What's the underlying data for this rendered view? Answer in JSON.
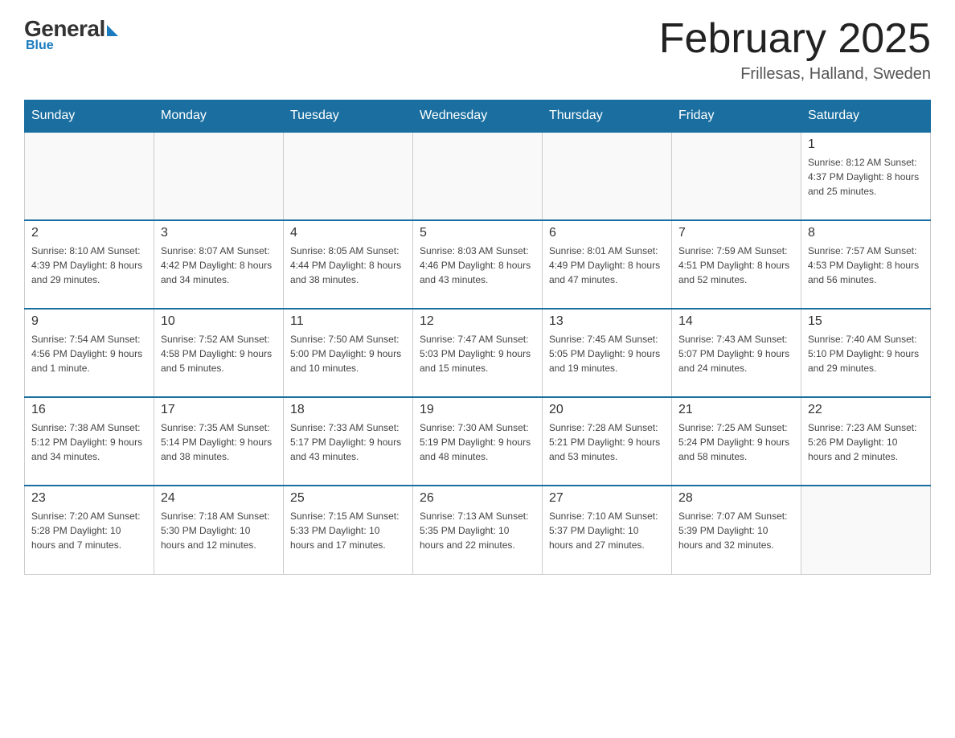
{
  "logo": {
    "general": "General",
    "blue": "Blue",
    "tagline": "Blue"
  },
  "header": {
    "title": "February 2025",
    "location": "Frillesas, Halland, Sweden"
  },
  "days_of_week": [
    "Sunday",
    "Monday",
    "Tuesday",
    "Wednesday",
    "Thursday",
    "Friday",
    "Saturday"
  ],
  "weeks": [
    [
      {
        "day": "",
        "info": ""
      },
      {
        "day": "",
        "info": ""
      },
      {
        "day": "",
        "info": ""
      },
      {
        "day": "",
        "info": ""
      },
      {
        "day": "",
        "info": ""
      },
      {
        "day": "",
        "info": ""
      },
      {
        "day": "1",
        "info": "Sunrise: 8:12 AM\nSunset: 4:37 PM\nDaylight: 8 hours and 25 minutes."
      }
    ],
    [
      {
        "day": "2",
        "info": "Sunrise: 8:10 AM\nSunset: 4:39 PM\nDaylight: 8 hours and 29 minutes."
      },
      {
        "day": "3",
        "info": "Sunrise: 8:07 AM\nSunset: 4:42 PM\nDaylight: 8 hours and 34 minutes."
      },
      {
        "day": "4",
        "info": "Sunrise: 8:05 AM\nSunset: 4:44 PM\nDaylight: 8 hours and 38 minutes."
      },
      {
        "day": "5",
        "info": "Sunrise: 8:03 AM\nSunset: 4:46 PM\nDaylight: 8 hours and 43 minutes."
      },
      {
        "day": "6",
        "info": "Sunrise: 8:01 AM\nSunset: 4:49 PM\nDaylight: 8 hours and 47 minutes."
      },
      {
        "day": "7",
        "info": "Sunrise: 7:59 AM\nSunset: 4:51 PM\nDaylight: 8 hours and 52 minutes."
      },
      {
        "day": "8",
        "info": "Sunrise: 7:57 AM\nSunset: 4:53 PM\nDaylight: 8 hours and 56 minutes."
      }
    ],
    [
      {
        "day": "9",
        "info": "Sunrise: 7:54 AM\nSunset: 4:56 PM\nDaylight: 9 hours and 1 minute."
      },
      {
        "day": "10",
        "info": "Sunrise: 7:52 AM\nSunset: 4:58 PM\nDaylight: 9 hours and 5 minutes."
      },
      {
        "day": "11",
        "info": "Sunrise: 7:50 AM\nSunset: 5:00 PM\nDaylight: 9 hours and 10 minutes."
      },
      {
        "day": "12",
        "info": "Sunrise: 7:47 AM\nSunset: 5:03 PM\nDaylight: 9 hours and 15 minutes."
      },
      {
        "day": "13",
        "info": "Sunrise: 7:45 AM\nSunset: 5:05 PM\nDaylight: 9 hours and 19 minutes."
      },
      {
        "day": "14",
        "info": "Sunrise: 7:43 AM\nSunset: 5:07 PM\nDaylight: 9 hours and 24 minutes."
      },
      {
        "day": "15",
        "info": "Sunrise: 7:40 AM\nSunset: 5:10 PM\nDaylight: 9 hours and 29 minutes."
      }
    ],
    [
      {
        "day": "16",
        "info": "Sunrise: 7:38 AM\nSunset: 5:12 PM\nDaylight: 9 hours and 34 minutes."
      },
      {
        "day": "17",
        "info": "Sunrise: 7:35 AM\nSunset: 5:14 PM\nDaylight: 9 hours and 38 minutes."
      },
      {
        "day": "18",
        "info": "Sunrise: 7:33 AM\nSunset: 5:17 PM\nDaylight: 9 hours and 43 minutes."
      },
      {
        "day": "19",
        "info": "Sunrise: 7:30 AM\nSunset: 5:19 PM\nDaylight: 9 hours and 48 minutes."
      },
      {
        "day": "20",
        "info": "Sunrise: 7:28 AM\nSunset: 5:21 PM\nDaylight: 9 hours and 53 minutes."
      },
      {
        "day": "21",
        "info": "Sunrise: 7:25 AM\nSunset: 5:24 PM\nDaylight: 9 hours and 58 minutes."
      },
      {
        "day": "22",
        "info": "Sunrise: 7:23 AM\nSunset: 5:26 PM\nDaylight: 10 hours and 2 minutes."
      }
    ],
    [
      {
        "day": "23",
        "info": "Sunrise: 7:20 AM\nSunset: 5:28 PM\nDaylight: 10 hours and 7 minutes."
      },
      {
        "day": "24",
        "info": "Sunrise: 7:18 AM\nSunset: 5:30 PM\nDaylight: 10 hours and 12 minutes."
      },
      {
        "day": "25",
        "info": "Sunrise: 7:15 AM\nSunset: 5:33 PM\nDaylight: 10 hours and 17 minutes."
      },
      {
        "day": "26",
        "info": "Sunrise: 7:13 AM\nSunset: 5:35 PM\nDaylight: 10 hours and 22 minutes."
      },
      {
        "day": "27",
        "info": "Sunrise: 7:10 AM\nSunset: 5:37 PM\nDaylight: 10 hours and 27 minutes."
      },
      {
        "day": "28",
        "info": "Sunrise: 7:07 AM\nSunset: 5:39 PM\nDaylight: 10 hours and 32 minutes."
      },
      {
        "day": "",
        "info": ""
      }
    ]
  ]
}
